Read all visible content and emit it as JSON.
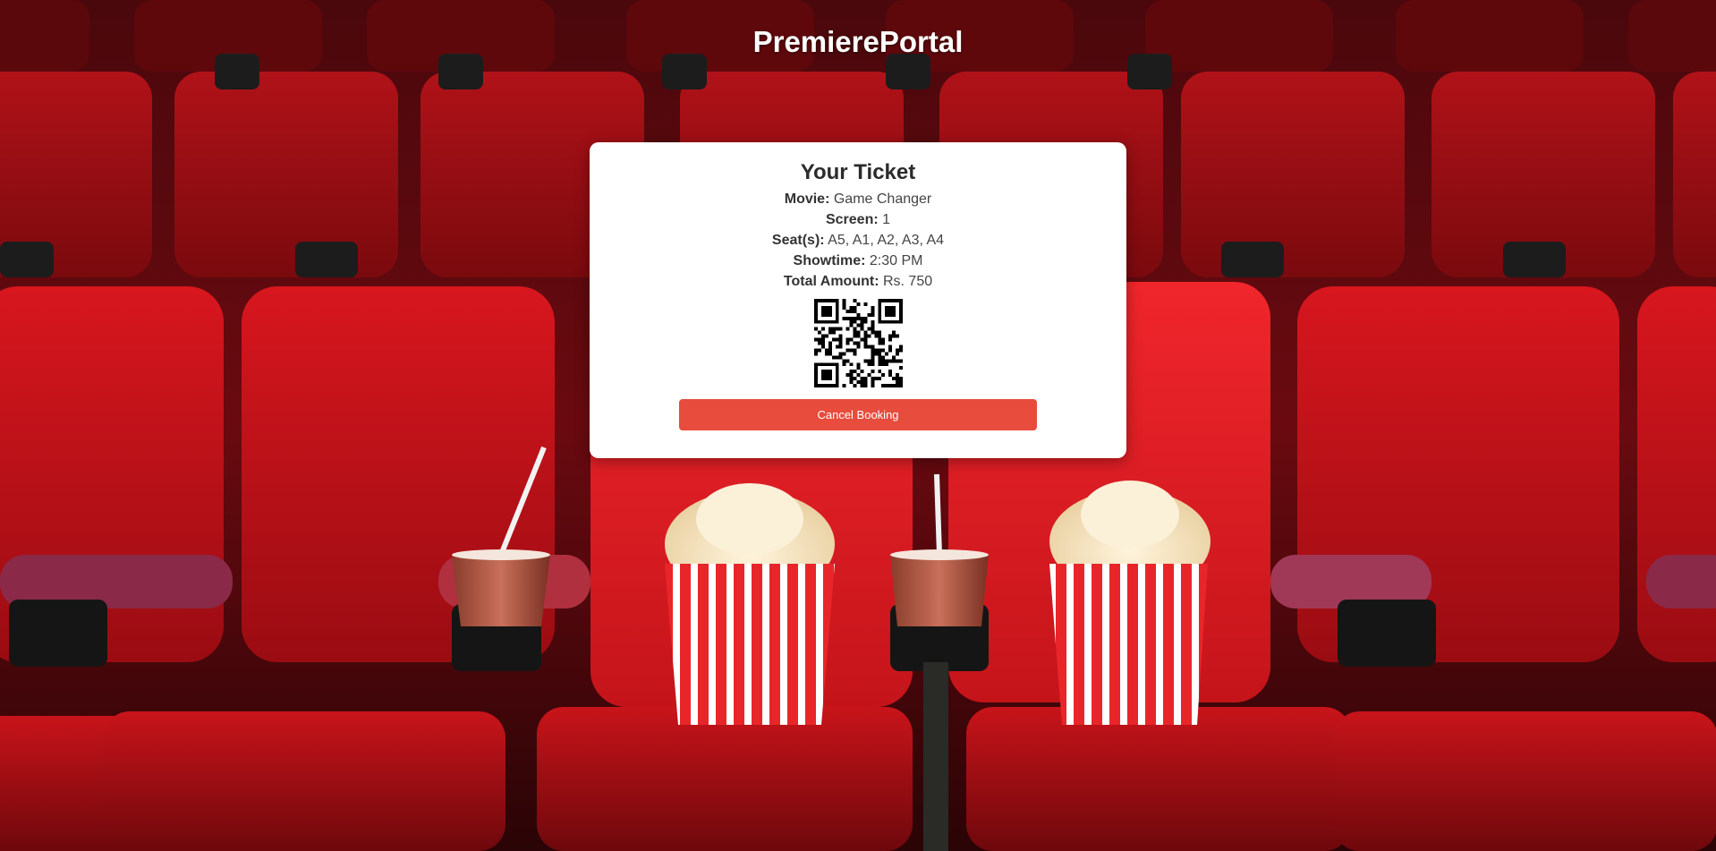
{
  "header": {
    "title": "PremierePortal"
  },
  "ticket": {
    "heading": "Your Ticket",
    "movie_label": "Movie:",
    "movie_value": "Game Changer",
    "screen_label": "Screen:",
    "screen_value": "1",
    "seats_label": "Seat(s):",
    "seats_value": "A5, A1, A2, A3, A4",
    "showtime_label": "Showtime:",
    "showtime_value": "2:30 PM",
    "amount_label": "Total Amount:",
    "amount_value": "Rs. 750",
    "qr_icon": "qr-code-icon",
    "cancel_label": "Cancel Booking"
  },
  "colors": {
    "accent": "#e74c3c",
    "seat_red": "#c0141a",
    "background_dark": "#3a0508"
  }
}
